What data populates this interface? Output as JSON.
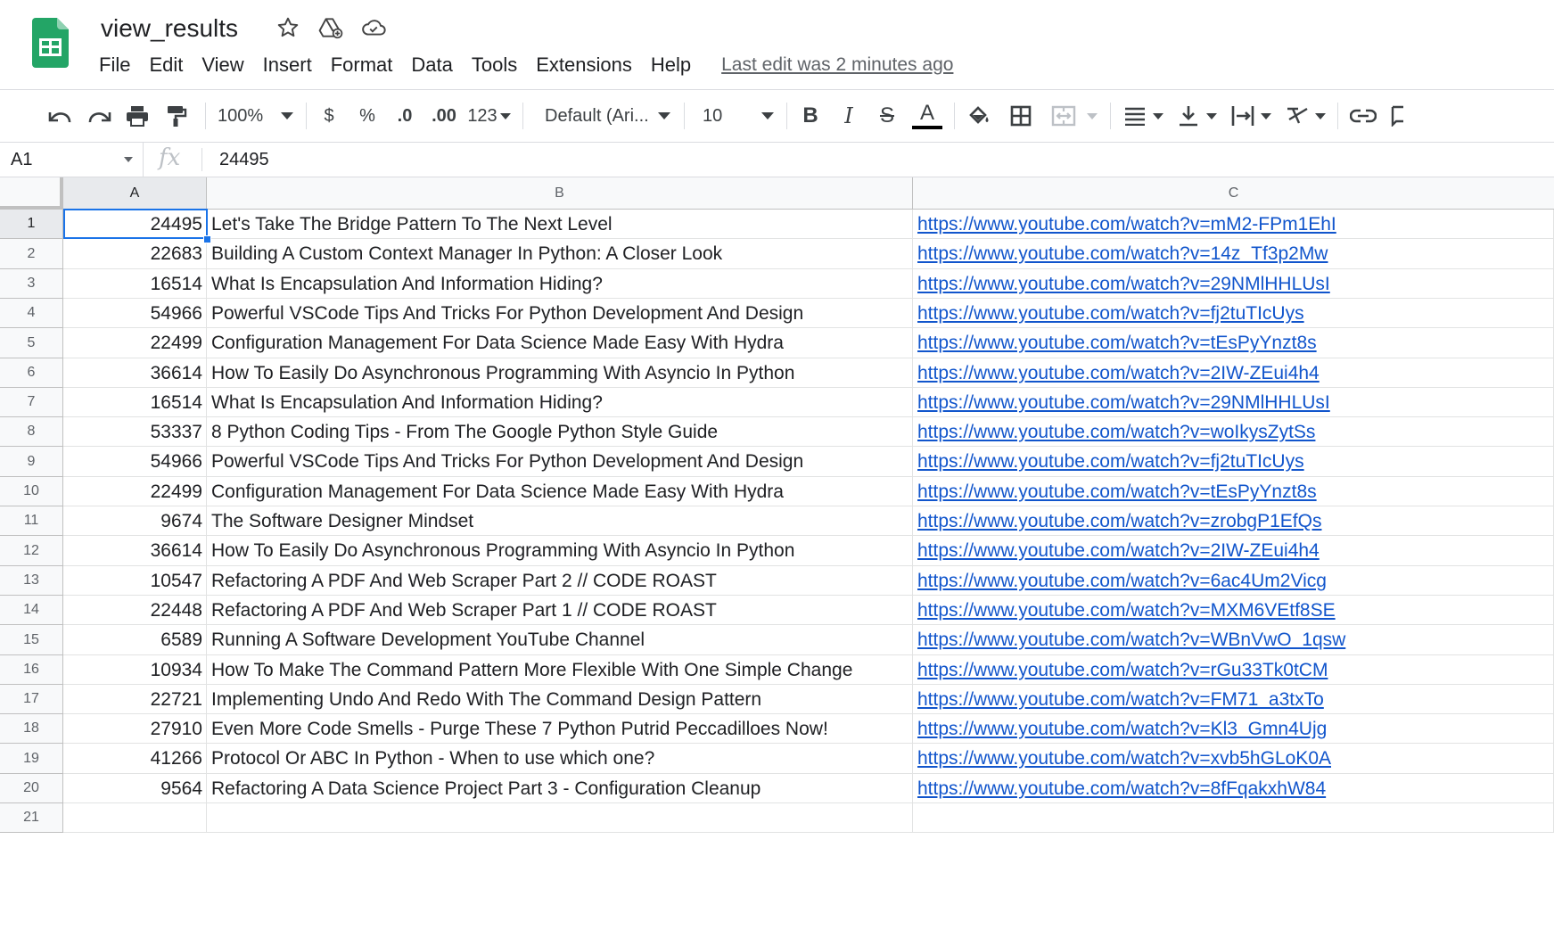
{
  "doc": {
    "title": "view_results",
    "last_edit": "Last edit was 2 minutes ago",
    "menus": [
      "File",
      "Edit",
      "View",
      "Insert",
      "Format",
      "Data",
      "Tools",
      "Extensions",
      "Help"
    ]
  },
  "toolbar": {
    "zoom": "100%",
    "currency": "$",
    "percent": "%",
    "decrease_decimal": ".0",
    "increase_decimal": ".00",
    "more_formats": "123",
    "font": "Default (Ari...",
    "font_size": "10"
  },
  "formula_bar": {
    "cell_ref": "A1",
    "fx": "fx",
    "value": "24495"
  },
  "sheet": {
    "columns": [
      "A",
      "B",
      "C"
    ],
    "rows": [
      {
        "n": "1",
        "a": "24495",
        "b": "Let's Take The Bridge Pattern To The Next Level",
        "c": "https://www.youtube.com/watch?v=mM2-FPm1EhI"
      },
      {
        "n": "2",
        "a": "22683",
        "b": "Building A Custom Context Manager In Python: A Closer Look",
        "c": "https://www.youtube.com/watch?v=14z_Tf3p2Mw"
      },
      {
        "n": "3",
        "a": "16514",
        "b": "What Is Encapsulation And Information Hiding?",
        "c": "https://www.youtube.com/watch?v=29NMlHHLUsI"
      },
      {
        "n": "4",
        "a": "54966",
        "b": "Powerful VSCode Tips And Tricks For Python Development And Design",
        "c": "https://www.youtube.com/watch?v=fj2tuTIcUys"
      },
      {
        "n": "5",
        "a": "22499",
        "b": "Configuration Management For Data Science Made Easy With Hydra",
        "c": "https://www.youtube.com/watch?v=tEsPyYnzt8s"
      },
      {
        "n": "6",
        "a": "36614",
        "b": "How To Easily Do Asynchronous Programming With Asyncio In Python",
        "c": "https://www.youtube.com/watch?v=2IW-ZEui4h4"
      },
      {
        "n": "7",
        "a": "16514",
        "b": "What Is Encapsulation And Information Hiding?",
        "c": "https://www.youtube.com/watch?v=29NMlHHLUsI"
      },
      {
        "n": "8",
        "a": "53337",
        "b": "8 Python Coding Tips - From The Google Python Style Guide",
        "c": "https://www.youtube.com/watch?v=woIkysZytSs"
      },
      {
        "n": "9",
        "a": "54966",
        "b": "Powerful VSCode Tips And Tricks For Python Development And Design",
        "c": "https://www.youtube.com/watch?v=fj2tuTIcUys"
      },
      {
        "n": "10",
        "a": "22499",
        "b": "Configuration Management For Data Science Made Easy With Hydra",
        "c": "https://www.youtube.com/watch?v=tEsPyYnzt8s"
      },
      {
        "n": "11",
        "a": "9674",
        "b": "The Software Designer Mindset",
        "c": "https://www.youtube.com/watch?v=zrobgP1EfQs"
      },
      {
        "n": "12",
        "a": "36614",
        "b": "How To Easily Do Asynchronous Programming With Asyncio In Python",
        "c": "https://www.youtube.com/watch?v=2IW-ZEui4h4"
      },
      {
        "n": "13",
        "a": "10547",
        "b": "Refactoring A PDF And Web Scraper Part 2 // CODE ROAST",
        "c": "https://www.youtube.com/watch?v=6ac4Um2Vicg"
      },
      {
        "n": "14",
        "a": "22448",
        "b": "Refactoring A PDF And Web Scraper Part 1 // CODE ROAST",
        "c": "https://www.youtube.com/watch?v=MXM6VEtf8SE"
      },
      {
        "n": "15",
        "a": "6589",
        "b": "Running A Software Development YouTube Channel",
        "c": "https://www.youtube.com/watch?v=WBnVwO_1qsw"
      },
      {
        "n": "16",
        "a": "10934",
        "b": "How To Make The Command Pattern More Flexible With One Simple Change",
        "c": "https://www.youtube.com/watch?v=rGu33Tk0tCM"
      },
      {
        "n": "17",
        "a": "22721",
        "b": "Implementing Undo And Redo With The Command Design Pattern",
        "c": "https://www.youtube.com/watch?v=FM71_a3txTo"
      },
      {
        "n": "18",
        "a": "27910",
        "b": "Even More Code Smells - Purge These 7 Python Putrid Peccadilloes Now!",
        "c": "https://www.youtube.com/watch?v=Kl3_Gmn4Ujg"
      },
      {
        "n": "19",
        "a": "41266",
        "b": "Protocol Or ABC In Python - When to use which one?",
        "c": "https://www.youtube.com/watch?v=xvb5hGLoK0A"
      },
      {
        "n": "20",
        "a": "9564",
        "b": "Refactoring A Data Science Project Part 3 - Configuration Cleanup",
        "c": "https://www.youtube.com/watch?v=8fFqakxhW84"
      },
      {
        "n": "21",
        "a": "",
        "b": "",
        "c": ""
      }
    ]
  },
  "icons": [
    "sheets-logo-icon",
    "star-icon",
    "move-to-drive-icon",
    "cloud-status-icon",
    "undo-icon",
    "redo-icon",
    "print-icon",
    "paint-format-icon",
    "bold-icon",
    "italic-icon",
    "strikethrough-icon",
    "text-color-icon",
    "fill-color-icon",
    "borders-icon",
    "merge-cells-icon",
    "horizontal-align-icon",
    "vertical-align-icon",
    "text-wrap-icon",
    "text-rotation-icon",
    "insert-link-icon"
  ],
  "colors": {
    "accent": "#1a73e8",
    "link": "#1155cc",
    "sheets_green": "#23a566"
  }
}
